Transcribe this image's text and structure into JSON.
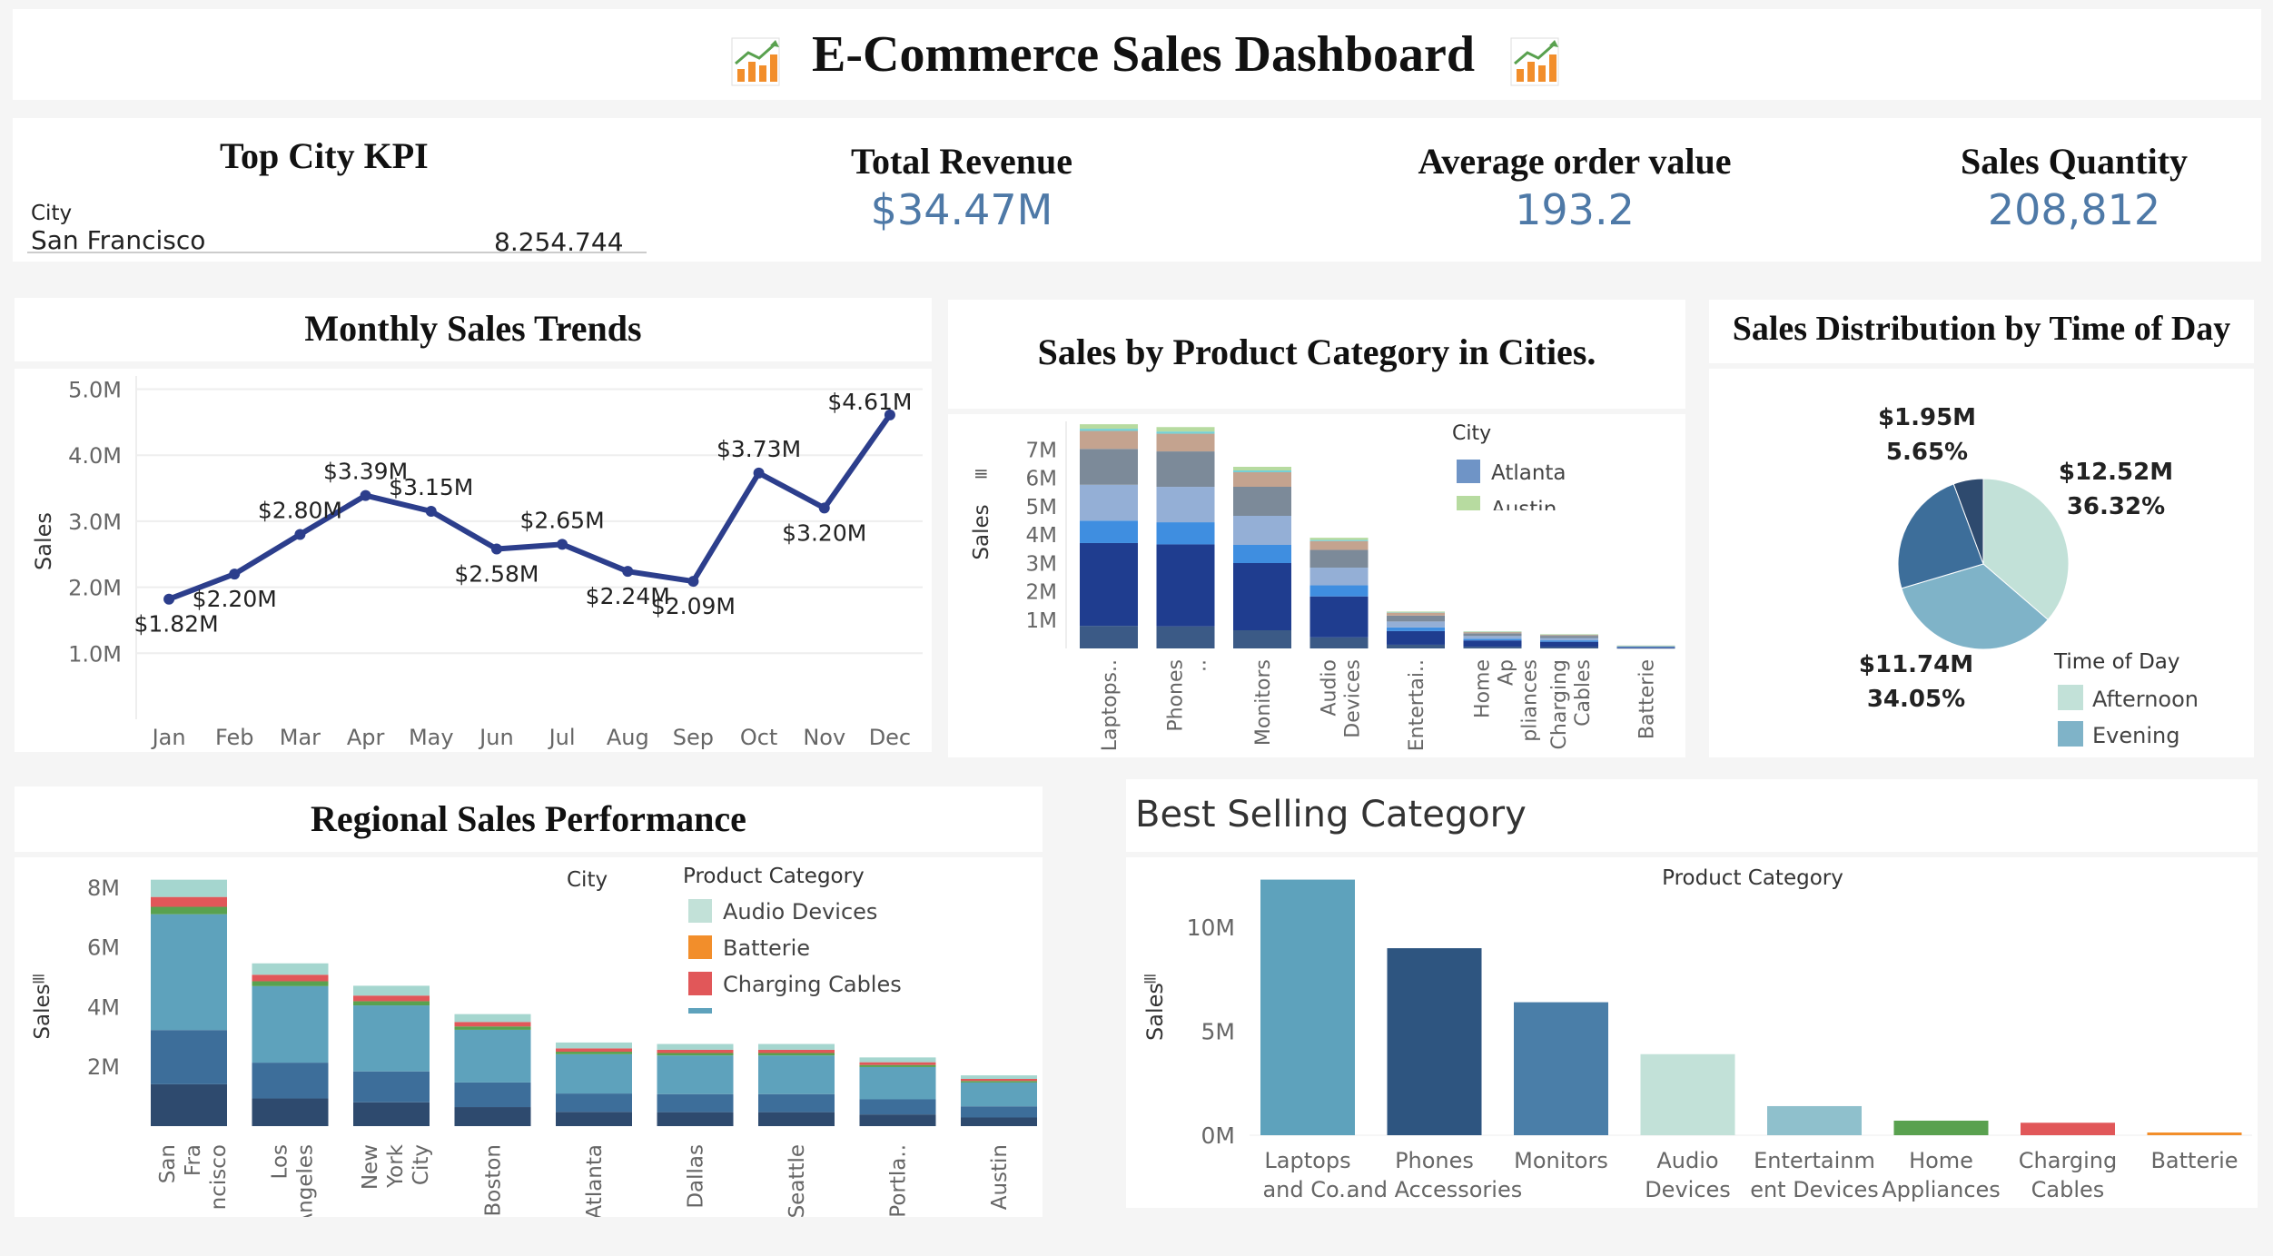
{
  "header": {
    "title": "E-Commerce Sales Dashboard",
    "icon": "chart-increasing-icon"
  },
  "kpis": {
    "top_city": {
      "title": "Top City KPI",
      "column_header": "City",
      "city": "San Francisco",
      "value": "8.254.744"
    },
    "total_revenue": {
      "title": "Total Revenue",
      "value": "$34.47M"
    },
    "avg_order_value": {
      "title": "Average order value",
      "value": "193.2"
    },
    "sales_quantity": {
      "title": "Sales Quantity",
      "value": "208,812"
    }
  },
  "colors": {
    "line": "#2c3e8c",
    "kpi_value": "#4e79a7",
    "palette": [
      "#3b5a86",
      "#1f3d8f",
      "#3f8ee0",
      "#94afd6",
      "#7c8a99",
      "#c4a38f",
      "#76d0d6",
      "#b7dba0",
      "#e15759",
      "#59a14f",
      "#f28e2b",
      "#a5d6cf",
      "#5ea2bc"
    ]
  },
  "chart_data": [
    {
      "id": "monthly",
      "type": "line",
      "title": "Monthly Sales Trends",
      "ylabel": "Sales",
      "categories": [
        "Jan",
        "Feb",
        "Mar",
        "Apr",
        "May",
        "Jun",
        "Jul",
        "Aug",
        "Sep",
        "Oct",
        "Nov",
        "Dec"
      ],
      "values": [
        1.82,
        2.2,
        2.8,
        3.39,
        3.15,
        2.58,
        2.65,
        2.24,
        2.09,
        3.73,
        3.2,
        4.61
      ],
      "labels": [
        "$1.82M",
        "$2.20M",
        "$2.80M",
        "$3.39M",
        "$3.15M",
        "$2.58M",
        "$2.65M",
        "$2.24M",
        "$2.09M",
        "$3.73M",
        "$3.20M",
        "$4.61M"
      ],
      "yticks": [
        "1.0M",
        "2.0M",
        "3.0M",
        "4.0M",
        "5.0M"
      ],
      "ylim": [
        0,
        5.2
      ]
    },
    {
      "id": "product_city",
      "type": "bar",
      "stacked": true,
      "title": "Sales by Product Category in Cities.",
      "ylabel": "Sales",
      "legend_title": "City",
      "legend": [
        "Atlanta",
        "Austin"
      ],
      "categories": [
        "Laptops..",
        "Phones ..",
        "Monitors",
        "Audio Devices",
        "Entertai..",
        "Home Ap pliances",
        "Charging Cables",
        "Batterie"
      ],
      "totals": [
        7.9,
        7.8,
        6.4,
        3.9,
        1.3,
        0.6,
        0.5,
        0.1
      ],
      "yticks": [
        "1M",
        "2M",
        "3M",
        "4M",
        "5M",
        "6M",
        "7M"
      ],
      "ylim": [
        0,
        8
      ]
    },
    {
      "id": "time_of_day",
      "type": "pie",
      "title": "Sales Distribution by Time of Day",
      "legend_title": "Time of Day",
      "legend": [
        "Afternoon",
        "Evening"
      ],
      "slices": [
        {
          "value": 12.52,
          "amount": "$12.52M",
          "pct": "36.32%"
        },
        {
          "value": 11.74,
          "amount": "$11.74M",
          "pct": "34.05%"
        },
        {
          "value": 8.26,
          "amount": "",
          "pct": ""
        },
        {
          "value": 1.95,
          "amount": "$1.95M",
          "pct": "5.65%"
        }
      ]
    },
    {
      "id": "regional",
      "type": "bar",
      "stacked": true,
      "title": "Regional Sales Performance",
      "ylabel": "Sales",
      "x_header": "City",
      "legend_title": "Product Category",
      "legend": [
        "Audio Devices",
        "Batterie",
        "Charging Cables"
      ],
      "categories": [
        "San Fra ncisco",
        "Los Angeles",
        "New York City",
        "Boston",
        "Atlanta",
        "Dallas",
        "Seattle",
        "Portla..",
        "Austin"
      ],
      "totals": [
        8.25,
        5.45,
        4.7,
        3.75,
        2.8,
        2.75,
        2.75,
        2.3,
        1.7
      ],
      "yticks": [
        "2M",
        "4M",
        "6M",
        "8M"
      ],
      "ylim": [
        0,
        9
      ]
    },
    {
      "id": "best_category",
      "type": "bar",
      "title": "Best Selling Category",
      "ylabel": "Sales",
      "x_header": "Product Category",
      "categories": [
        "Laptops and Co..",
        "Phones and Accessories",
        "Monitors",
        "Audio Devices",
        "Entertainm ent Devices",
        "Home Appliances",
        "Charging Cables",
        "Batterie"
      ],
      "values": [
        12.3,
        9.0,
        6.4,
        3.9,
        1.4,
        0.7,
        0.6,
        0.1
      ],
      "yticks": [
        "0M",
        "5M",
        "10M"
      ],
      "ylim": [
        0,
        12.5
      ]
    }
  ]
}
